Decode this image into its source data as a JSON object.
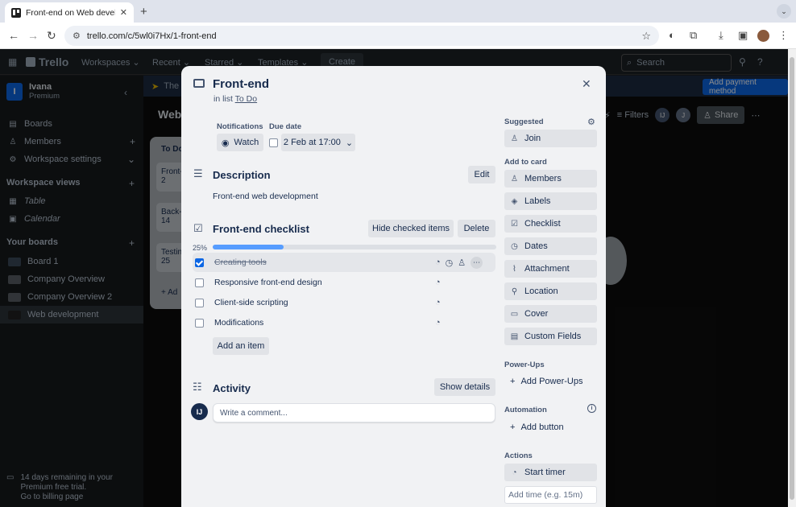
{
  "browser": {
    "tab_title": "Front-end on Web developme",
    "url": "trello.com/c/5wl0i7Hx/1-front-end"
  },
  "header": {
    "logo": "Trello",
    "menus": [
      "Workspaces",
      "Recent",
      "Starred",
      "Templates"
    ],
    "create_label": "Create",
    "search_placeholder": "Search"
  },
  "sidebar": {
    "workspace_initial": "I",
    "workspace_name": "Ivana",
    "workspace_plan": "Premium",
    "items": [
      {
        "label": "Boards"
      },
      {
        "label": "Members"
      },
      {
        "label": "Workspace settings"
      }
    ],
    "views_title": "Workspace views",
    "views": [
      {
        "label": "Table"
      },
      {
        "label": "Calendar"
      }
    ],
    "boards_title": "Your boards",
    "boards": [
      {
        "label": "Board 1"
      },
      {
        "label": "Company Overview"
      },
      {
        "label": "Company Overview 2"
      },
      {
        "label": "Web development"
      }
    ],
    "trial_text": "14 days remaining in your Premium free trial.",
    "trial_link": "Go to billing page"
  },
  "board": {
    "banner_text": "The",
    "pay_label": "Add payment method",
    "title": "Web",
    "filters_label": "Filters",
    "share_label": "Share",
    "member_initials": [
      "IJ",
      "J"
    ],
    "list_title": "To Do",
    "cards": [
      "Front-",
      "Back-",
      "Testin"
    ],
    "card_meta": [
      "2",
      "14",
      "25"
    ],
    "add_card": "Ad"
  },
  "card": {
    "title": "Front-end",
    "in_list_prefix": "in list",
    "list_name": "To Do",
    "notifications_label": "Notifications",
    "watch_label": "Watch",
    "due_label": "Due date",
    "due_value": "2 Feb at 17:00",
    "description_title": "Description",
    "edit_label": "Edit",
    "description_text": "Front-end web development",
    "checklist_title": "Front-end checklist",
    "hide_checked_label": "Hide checked items",
    "delete_label": "Delete",
    "progress_pct": "25%",
    "progress_value": 25,
    "checklist_items": [
      {
        "text": "Creating tools",
        "done": true
      },
      {
        "text": "Responsive front-end design",
        "done": false
      },
      {
        "text": "Client-side scripting",
        "done": false
      },
      {
        "text": "Modifications",
        "done": false
      }
    ],
    "add_item_label": "Add an item",
    "activity_title": "Activity",
    "show_details_label": "Show details",
    "comment_avatar": "IJ",
    "comment_placeholder": "Write a comment..."
  },
  "right": {
    "suggested_label": "Suggested",
    "join_label": "Join",
    "add_to_card_label": "Add to card",
    "add_to_card": [
      "Members",
      "Labels",
      "Checklist",
      "Dates",
      "Attachment",
      "Location",
      "Cover",
      "Custom Fields"
    ],
    "powerups_label": "Power-Ups",
    "add_powerups": "Add Power-Ups",
    "automation_label": "Automation",
    "add_button": "Add button",
    "actions_label": "Actions",
    "start_timer": "Start timer",
    "add_time_placeholder": "Add time (e.g. 15m)"
  },
  "colors": {
    "accent": "#0c66e4",
    "progress": "#579dff",
    "modal_bg": "#f1f2f4"
  }
}
